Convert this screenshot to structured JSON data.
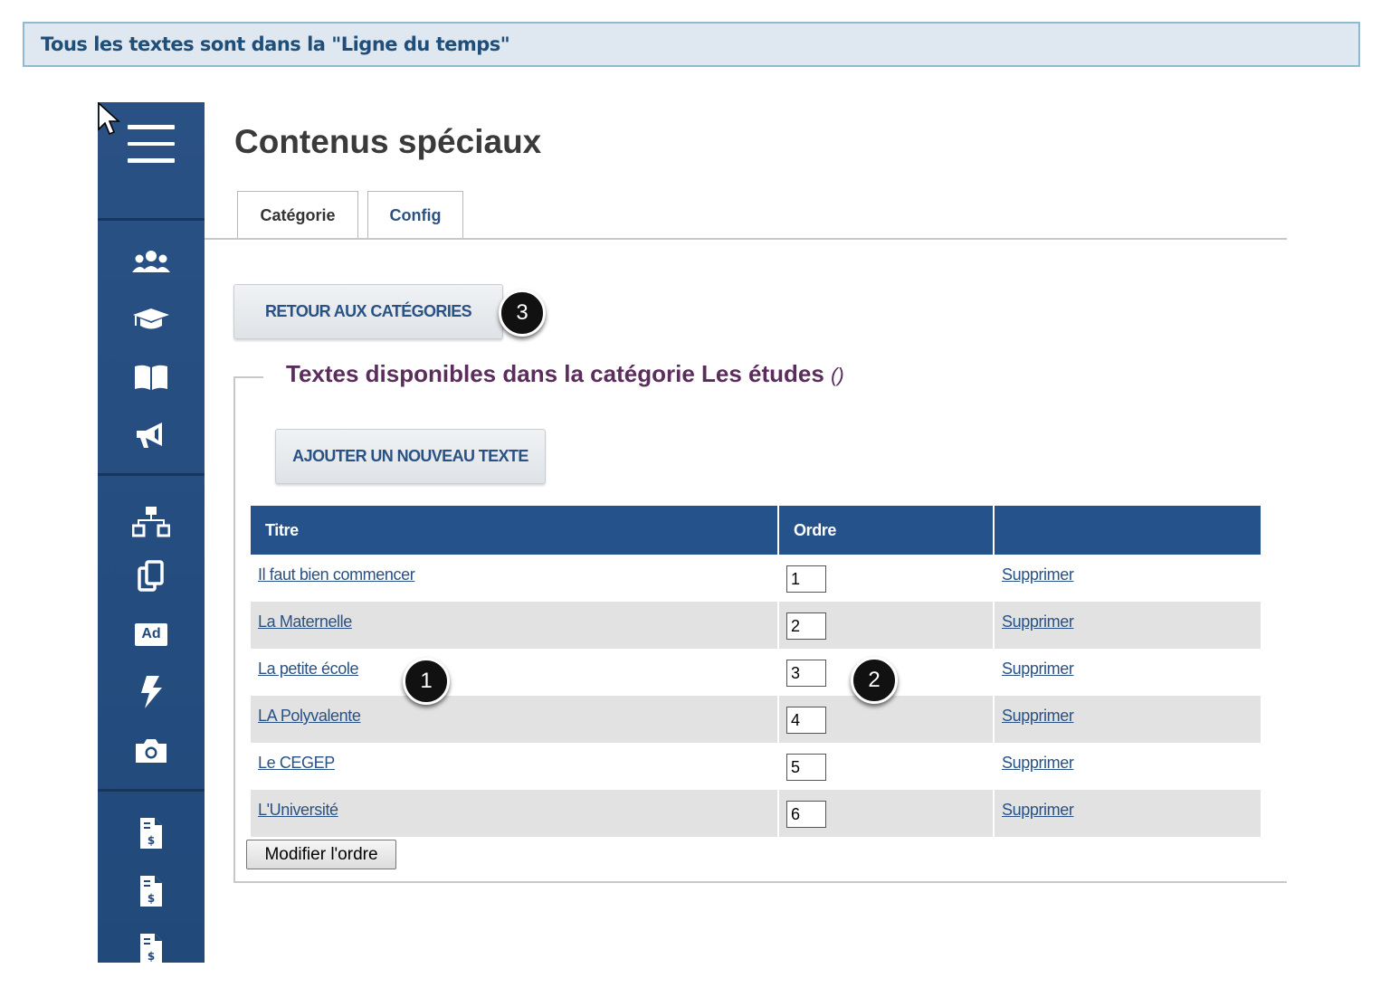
{
  "banner": {
    "text": "Tous les textes sont dans la \"Ligne du temps\""
  },
  "sidebar": {
    "icons": [
      "menu-icon",
      "users-icon",
      "graduation-cap-icon",
      "book-icon",
      "megaphone-icon",
      "sitemap-icon",
      "copy-icon",
      "ad-icon",
      "bolt-icon",
      "camera-icon",
      "invoice-icon",
      "invoice-icon",
      "invoice-icon"
    ],
    "ad_label": "Ad"
  },
  "page": {
    "title": "Contenus spéciaux"
  },
  "tabs": [
    {
      "label": "Catégorie",
      "active": true
    },
    {
      "label": "Config",
      "active": false
    }
  ],
  "buttons": {
    "return_label": "RETOUR AUX CATÉGORIES",
    "add_label": "AJOUTER UN NOUVEAU TEXTE",
    "modify_label": "Modifier l'ordre"
  },
  "section": {
    "legend": "Textes disponibles dans la catégorie Les études",
    "count": "()"
  },
  "table": {
    "headers": [
      "Titre",
      "Ordre",
      ""
    ],
    "delete_label": "Supprimer",
    "rows": [
      {
        "title": "Il faut bien commencer",
        "order": "1"
      },
      {
        "title": "La Maternelle",
        "order": "2"
      },
      {
        "title": "La petite école",
        "order": "3"
      },
      {
        "title": "LA Polyvalente",
        "order": "4"
      },
      {
        "title": "Le CEGEP",
        "order": "5"
      },
      {
        "title": "L'Université",
        "order": "6"
      }
    ]
  },
  "callouts": [
    "1",
    "2",
    "3"
  ],
  "colors": {
    "sidebar": "#25528a",
    "header": "#25528a",
    "legend": "#5b2d5c",
    "link": "#2a5184"
  }
}
